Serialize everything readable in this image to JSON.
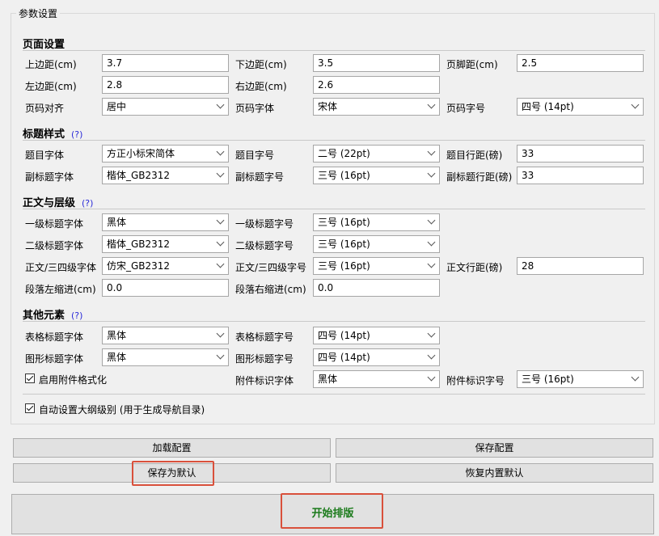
{
  "groupbox_title": "参数设置",
  "help_mark": "(?)",
  "page": {
    "title": "页面设置",
    "top_margin": {
      "label": "上边距(cm)",
      "value": "3.7"
    },
    "bottom_margin": {
      "label": "下边距(cm)",
      "value": "3.5"
    },
    "footer_margin": {
      "label": "页脚距(cm)",
      "value": "2.5"
    },
    "left_margin": {
      "label": "左边距(cm)",
      "value": "2.8"
    },
    "right_margin": {
      "label": "右边距(cm)",
      "value": "2.6"
    },
    "pagenum_align": {
      "label": "页码对齐",
      "value": "居中"
    },
    "pagenum_font": {
      "label": "页码字体",
      "value": "宋体"
    },
    "pagenum_size": {
      "label": "页码字号",
      "value": "四号 (14pt)"
    }
  },
  "heading": {
    "title": "标题样式",
    "title_font": {
      "label": "题目字体",
      "value": "方正小标宋简体"
    },
    "title_size": {
      "label": "题目字号",
      "value": "二号 (22pt)"
    },
    "title_spacing": {
      "label": "题目行距(磅)",
      "value": "33"
    },
    "subtitle_font": {
      "label": "副标题字体",
      "value": "楷体_GB2312"
    },
    "subtitle_size": {
      "label": "副标题字号",
      "value": "三号 (16pt)"
    },
    "subtitle_spacing": {
      "label": "副标题行距(磅)",
      "value": "33"
    }
  },
  "body": {
    "title": "正文与层级",
    "h1_font": {
      "label": "一级标题字体",
      "value": "黑体"
    },
    "h1_size": {
      "label": "一级标题字号",
      "value": "三号 (16pt)"
    },
    "h2_font": {
      "label": "二级标题字体",
      "value": "楷体_GB2312"
    },
    "h2_size": {
      "label": "二级标题字号",
      "value": "三号 (16pt)"
    },
    "text_font": {
      "label": "正文/三四级字体",
      "value": "仿宋_GB2312"
    },
    "text_size": {
      "label": "正文/三四级字号",
      "value": "三号 (16pt)"
    },
    "text_spacing": {
      "label": "正文行距(磅)",
      "value": "28"
    },
    "indent_left": {
      "label": "段落左缩进(cm)",
      "value": "0.0"
    },
    "indent_right": {
      "label": "段落右缩进(cm)",
      "value": "0.0"
    }
  },
  "other": {
    "title": "其他元素",
    "table_font": {
      "label": "表格标题字体",
      "value": "黑体"
    },
    "table_size": {
      "label": "表格标题字号",
      "value": "四号 (14pt)"
    },
    "figure_font": {
      "label": "图形标题字体",
      "value": "黑体"
    },
    "figure_size": {
      "label": "图形标题字号",
      "value": "四号 (14pt)"
    },
    "attach_enable": {
      "label": "启用附件格式化",
      "checked": true
    },
    "attach_font": {
      "label": "附件标识字体",
      "value": "黑体"
    },
    "attach_size": {
      "label": "附件标识字号",
      "value": "三号 (16pt)"
    }
  },
  "auto_outline": {
    "label": "自动设置大纲级别 (用于生成导航目录)",
    "checked": true
  },
  "buttons": {
    "load": "加载配置",
    "save": "保存配置",
    "save_default": "保存为默认",
    "restore_default": "恢复内置默认",
    "start": "开始排版"
  },
  "colors": {
    "highlight": "#d9503b",
    "start_text": "#1a7a1a",
    "help_link": "#2b2bd8"
  }
}
